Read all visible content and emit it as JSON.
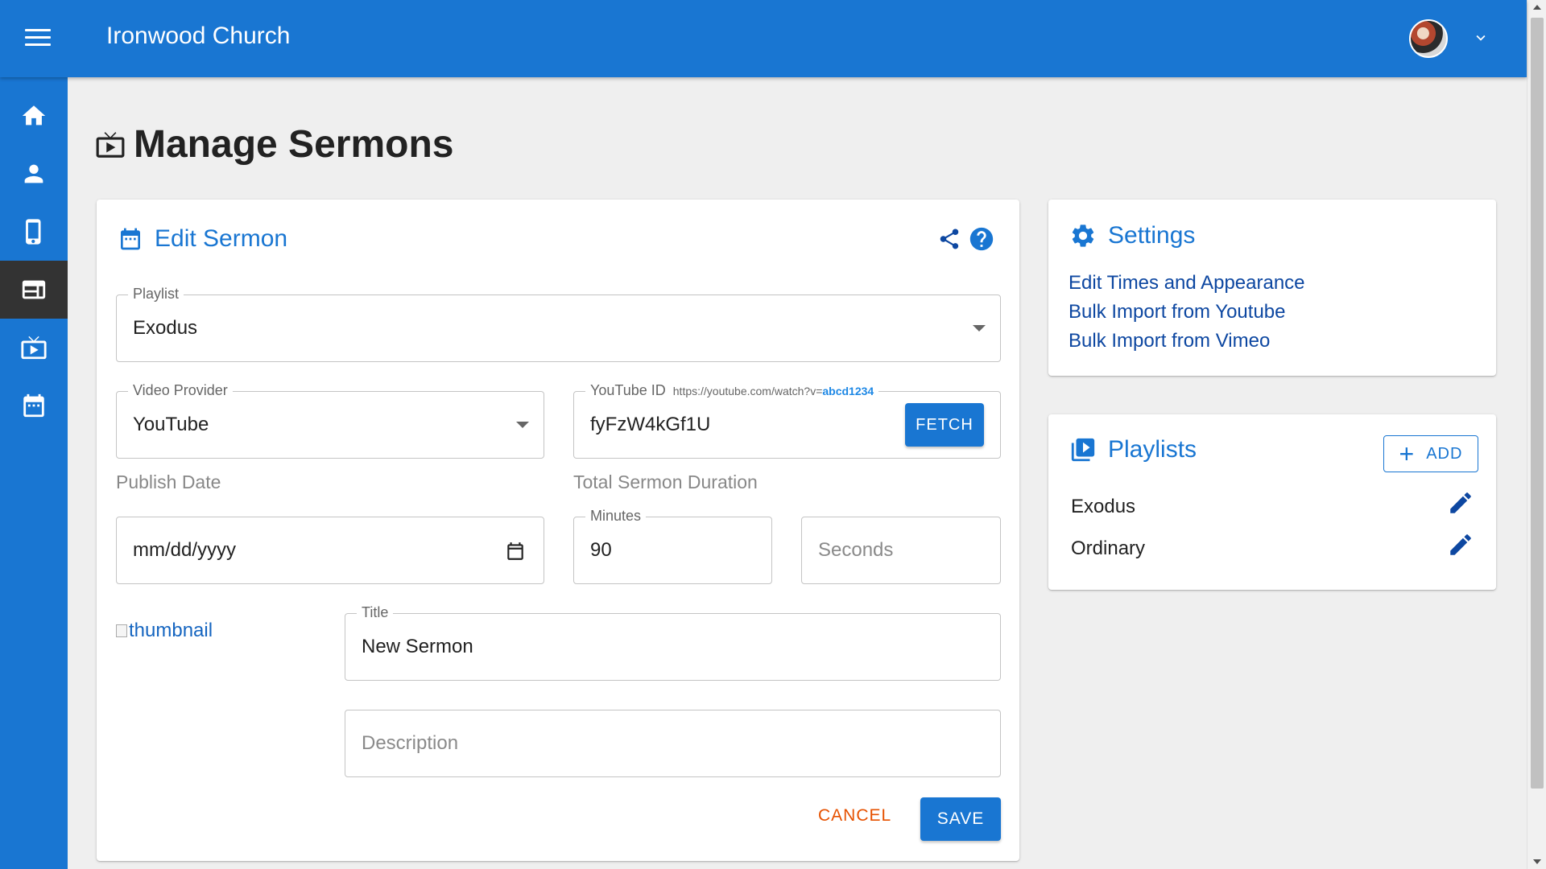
{
  "app": {
    "title": "Ironwood Church"
  },
  "sidebar": {
    "items": [
      {
        "icon": "home-icon",
        "active": false
      },
      {
        "icon": "person-icon",
        "active": false
      },
      {
        "icon": "mobile-icon",
        "active": false
      },
      {
        "icon": "website-icon",
        "active": true
      },
      {
        "icon": "tv-play-icon",
        "active": false
      },
      {
        "icon": "calendar-icon",
        "active": false
      }
    ]
  },
  "page": {
    "title": "Manage Sermons"
  },
  "edit_sermon": {
    "header": "Edit Sermon",
    "playlist": {
      "label": "Playlist",
      "value": "Exodus"
    },
    "video_provider": {
      "label": "Video Provider",
      "value": "YouTube"
    },
    "youtube_id": {
      "label": "YouTube ID",
      "hint_prefix": "https://youtube.com/watch?v=",
      "hint_id": "abcd1234",
      "value": "fyFzW4kGf1U",
      "fetch_label": "FETCH"
    },
    "publish_date": {
      "section_label": "Publish Date",
      "placeholder": "mm/dd/yyyy"
    },
    "duration": {
      "section_label": "Total Sermon Duration",
      "minutes_label": "Minutes",
      "minutes_value": "90",
      "seconds_placeholder": "Seconds"
    },
    "thumbnail_alt": "thumbnail",
    "title_field": {
      "label": "Title",
      "value": "New Sermon"
    },
    "description_placeholder": "Description",
    "cancel_label": "CANCEL",
    "save_label": "SAVE"
  },
  "settings": {
    "header": "Settings",
    "links": [
      "Edit Times and Appearance",
      "Bulk Import from Youtube",
      "Bulk Import from Vimeo"
    ]
  },
  "playlists": {
    "header": "Playlists",
    "add_label": "ADD",
    "items": [
      "Exodus",
      "Ordinary"
    ]
  },
  "colors": {
    "primary": "#1976d2",
    "link": "#0d47a1",
    "cancel": "#e65100",
    "sidebar_active": "#333333",
    "background": "#efefef"
  }
}
